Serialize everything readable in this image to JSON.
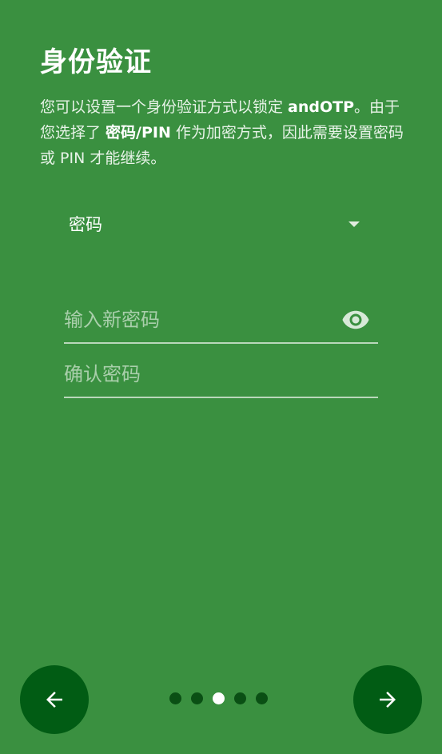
{
  "header": {
    "title": "身份验证"
  },
  "description": {
    "part1": "您可以设置一个身份验证方式以锁定 ",
    "app_name": "andOTP",
    "part2": "。由于您选择了 ",
    "encryption_method": "密码/PIN",
    "part3": " 作为加密方式，因此需要设置密码或 PIN 才能继续。"
  },
  "auth_method": {
    "selected": "密码"
  },
  "fields": {
    "new_password_placeholder": "输入新密码",
    "confirm_password_placeholder": "确认密码"
  },
  "pager": {
    "total": 5,
    "current": 3
  },
  "colors": {
    "background": "#3a9040",
    "fab": "#015c14",
    "dot_inactive": "#0a4f14",
    "dot_active": "#ffffff"
  },
  "icons": {
    "visibility": "eye-icon",
    "back": "arrow-left-icon",
    "next": "arrow-right-icon",
    "dropdown": "dropdown-caret-icon"
  }
}
